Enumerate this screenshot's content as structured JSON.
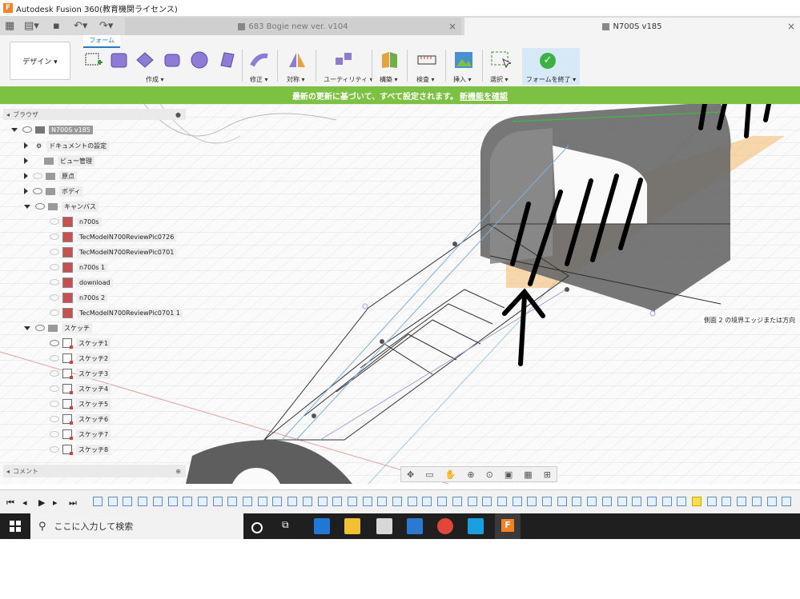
{
  "window": {
    "title": "Autodesk Fusion 360(教育機関ライセンス)",
    "app_letter": "F"
  },
  "tabs": [
    {
      "label": "683 Bogie new ver. v104",
      "active": false
    },
    {
      "label": "N700S v185",
      "active": true
    }
  ],
  "ribbon": {
    "workspace_tab": "フォーム",
    "design_button": "デザイン ▾",
    "groups": {
      "create": "作成 ▾",
      "modify": "修正 ▾",
      "symmetry": "対称 ▾",
      "utility": "ユーティリティ ▾",
      "construct": "構築 ▾",
      "inspect": "検査 ▾",
      "insert": "挿入 ▾",
      "select": "選択 ▾",
      "finish": "フォームを終了 ▾"
    }
  },
  "banner": {
    "text": "最新の更新に基づいて、すべて設定されます。",
    "link": "新機能を確認"
  },
  "browser": {
    "header": "ブラウザ",
    "root": "N700S v185",
    "items": [
      {
        "label": "ドキュメントの設定",
        "kind": "gear"
      },
      {
        "label": "ビュー管理",
        "kind": "folder"
      },
      {
        "label": "原点",
        "kind": "folder"
      },
      {
        "label": "ボディ",
        "kind": "folder"
      },
      {
        "label": "キャンバス",
        "kind": "folder"
      }
    ],
    "canvases": [
      "n700s",
      "TecModelN700ReviewPic0726",
      "TecModelN700ReviewPic0701",
      "n700s 1",
      "download",
      "n700s 2",
      "TecModelN700ReviewPic0701 1"
    ],
    "sketch_folder": "スケッチ",
    "sketches": [
      "スケッチ1",
      "スケッチ2",
      "スケッチ3",
      "スケッチ4",
      "スケッチ5",
      "スケッチ6",
      "スケッチ7",
      "スケッチ8"
    ]
  },
  "comments": {
    "label": "コメント"
  },
  "viewport": {
    "callout": "側面 2 の境界エッジまたは方向"
  },
  "taskbar": {
    "search_placeholder": "ここに入力して検索"
  },
  "colors": {
    "accent": "#1a7fd4",
    "banner": "#7cc142",
    "taskbar": "#1f1f1f"
  }
}
